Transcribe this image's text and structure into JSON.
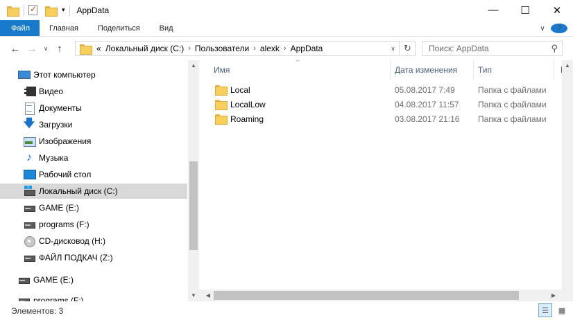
{
  "window": {
    "title": "AppData",
    "controls": {
      "minimize": "—",
      "maximize": "☐",
      "close": "✕"
    }
  },
  "ribbon": {
    "tabs": [
      {
        "label": "Файл"
      },
      {
        "label": "Главная"
      },
      {
        "label": "Поделиться"
      },
      {
        "label": "Вид"
      }
    ],
    "expand_glyph": "∨"
  },
  "address": {
    "overflow": "«",
    "crumbs": [
      "Локальный диск (C:)",
      "Пользователи",
      "alexk",
      "AppData"
    ],
    "separator": "›"
  },
  "search": {
    "placeholder": "Поиск: AppData"
  },
  "nav": {
    "items": [
      {
        "label": "Этот компьютер",
        "icon": "computer-icon"
      },
      {
        "label": "Видео",
        "icon": "video-icon"
      },
      {
        "label": "Документы",
        "icon": "documents-icon"
      },
      {
        "label": "Загрузки",
        "icon": "downloads-icon"
      },
      {
        "label": "Изображения",
        "icon": "pictures-icon"
      },
      {
        "label": "Музыка",
        "icon": "music-icon"
      },
      {
        "label": "Рабочий стол",
        "icon": "desktop-icon"
      },
      {
        "label": "Локальный диск (C:)",
        "icon": "system-drive-icon",
        "selected": true
      },
      {
        "label": "GAME (E:)",
        "icon": "drive-icon"
      },
      {
        "label": "programs (F:)",
        "icon": "drive-icon"
      },
      {
        "label": "CD-дисковод (H:)",
        "icon": "cd-drive-icon"
      },
      {
        "label": "ФАЙЛ ПОДКАЧ (Z:)",
        "icon": "drive-icon"
      },
      {
        "label": "GAME (E:)",
        "icon": "drive-icon"
      },
      {
        "label": "programs (F:)",
        "icon": "drive-icon"
      }
    ]
  },
  "columns": {
    "name": "Имя",
    "date": "Дата изменения",
    "type": "Тип",
    "size": "Ра"
  },
  "files": [
    {
      "name": "Local",
      "date": "05.08.2017 7:49",
      "type": "Папка с файлами"
    },
    {
      "name": "LocalLow",
      "date": "04.08.2017 11:57",
      "type": "Папка с файлами"
    },
    {
      "name": "Roaming",
      "date": "03.08.2017 21:16",
      "type": "Папка с файлами"
    }
  ],
  "status": {
    "count": "Элементов: 3"
  },
  "colors": {
    "accent": "#1979ca",
    "selected_bg": "#d9d9d9",
    "header_text": "#4c607a"
  }
}
